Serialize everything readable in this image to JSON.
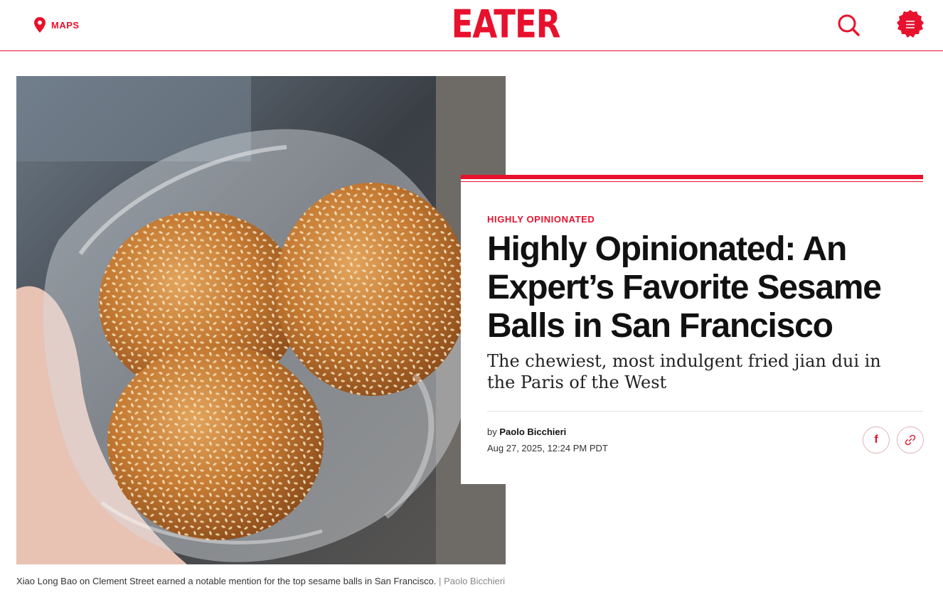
{
  "header": {
    "maps_label": "MAPS",
    "logo_text": "EATER"
  },
  "hero": {
    "caption": "Xiao Long Bao on Clement Street earned a notable mention for the top sesame balls in San Francisco.",
    "separator": "|",
    "credit": "Paolo Bicchieri"
  },
  "article": {
    "kicker": "HIGHLY OPINIONATED",
    "headline": "Highly Opinionated: An Expert’s Favorite Sesame Balls in San Francisco",
    "dek": "The chewiest, most indulgent fried jian dui in the Paris of the West",
    "byline_prefix": "by",
    "author": "Paolo Bicchieri",
    "timestamp": "Aug 27, 2025, 12:24 PM PDT"
  },
  "share": {
    "facebook_glyph": "f"
  },
  "icons": {
    "maps": "map-pin-icon",
    "search": "search-icon",
    "menu": "menu-icon",
    "facebook": "facebook-icon",
    "link": "link-icon"
  },
  "colors": {
    "brand_red": "#e8112d",
    "text": "#111111",
    "caption_credit": "#888888"
  }
}
